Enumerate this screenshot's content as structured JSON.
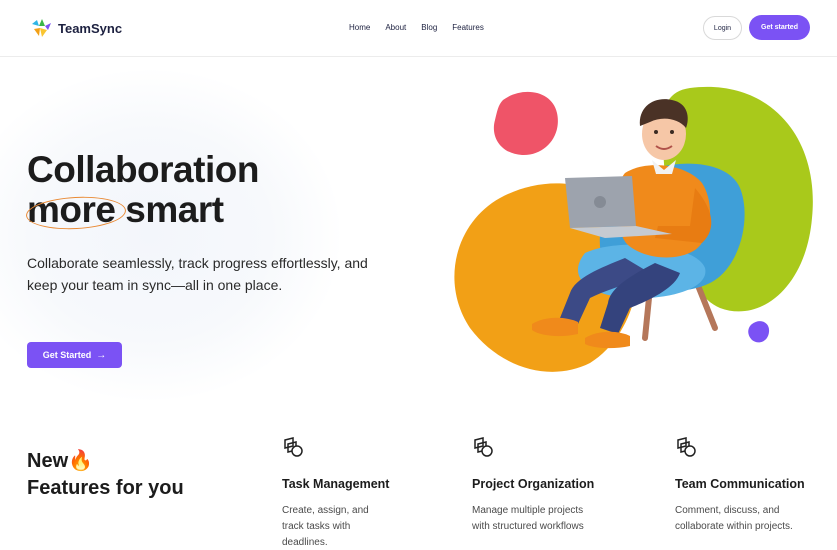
{
  "app": {
    "name": "TeamSync",
    "brand_color": "#7b52f4"
  },
  "nav": {
    "items": [
      "Home",
      "About",
      "Blog",
      "Features"
    ]
  },
  "header": {
    "login_label": "Login",
    "get_started_label": "Get started"
  },
  "hero": {
    "title_line1": "Collaboration",
    "title_word_circled": "more",
    "title_word_rest": "smart",
    "subtitle": "Collaborate seamlessly, track progress effortlessly, and keep your team in sync—all in one place.",
    "cta_label": "Get Started",
    "cta_icon": "arrow-right-icon",
    "illustration": "person-with-laptop-in-armchair"
  },
  "features": {
    "heading_line1": "New",
    "heading_emoji": "🔥",
    "heading_line2": "Features for you",
    "items": [
      {
        "icon": "shapes-icon",
        "title": "Task Management",
        "description": "Create, assign, and track tasks with deadlines."
      },
      {
        "icon": "shapes-icon",
        "title": "Project Organization",
        "description": "Manage multiple projects with structured workflows"
      },
      {
        "icon": "shapes-icon",
        "title": "Team Communication",
        "description": "Comment, discuss, and collaborate within projects."
      }
    ]
  },
  "colors": {
    "accent": "#7b52f4",
    "orange_blob": "#f2a016",
    "green_blob": "#a9c91b",
    "pink_blob": "#ef5468",
    "purple_blob": "#7b52f4",
    "ring": "#e98a35"
  }
}
